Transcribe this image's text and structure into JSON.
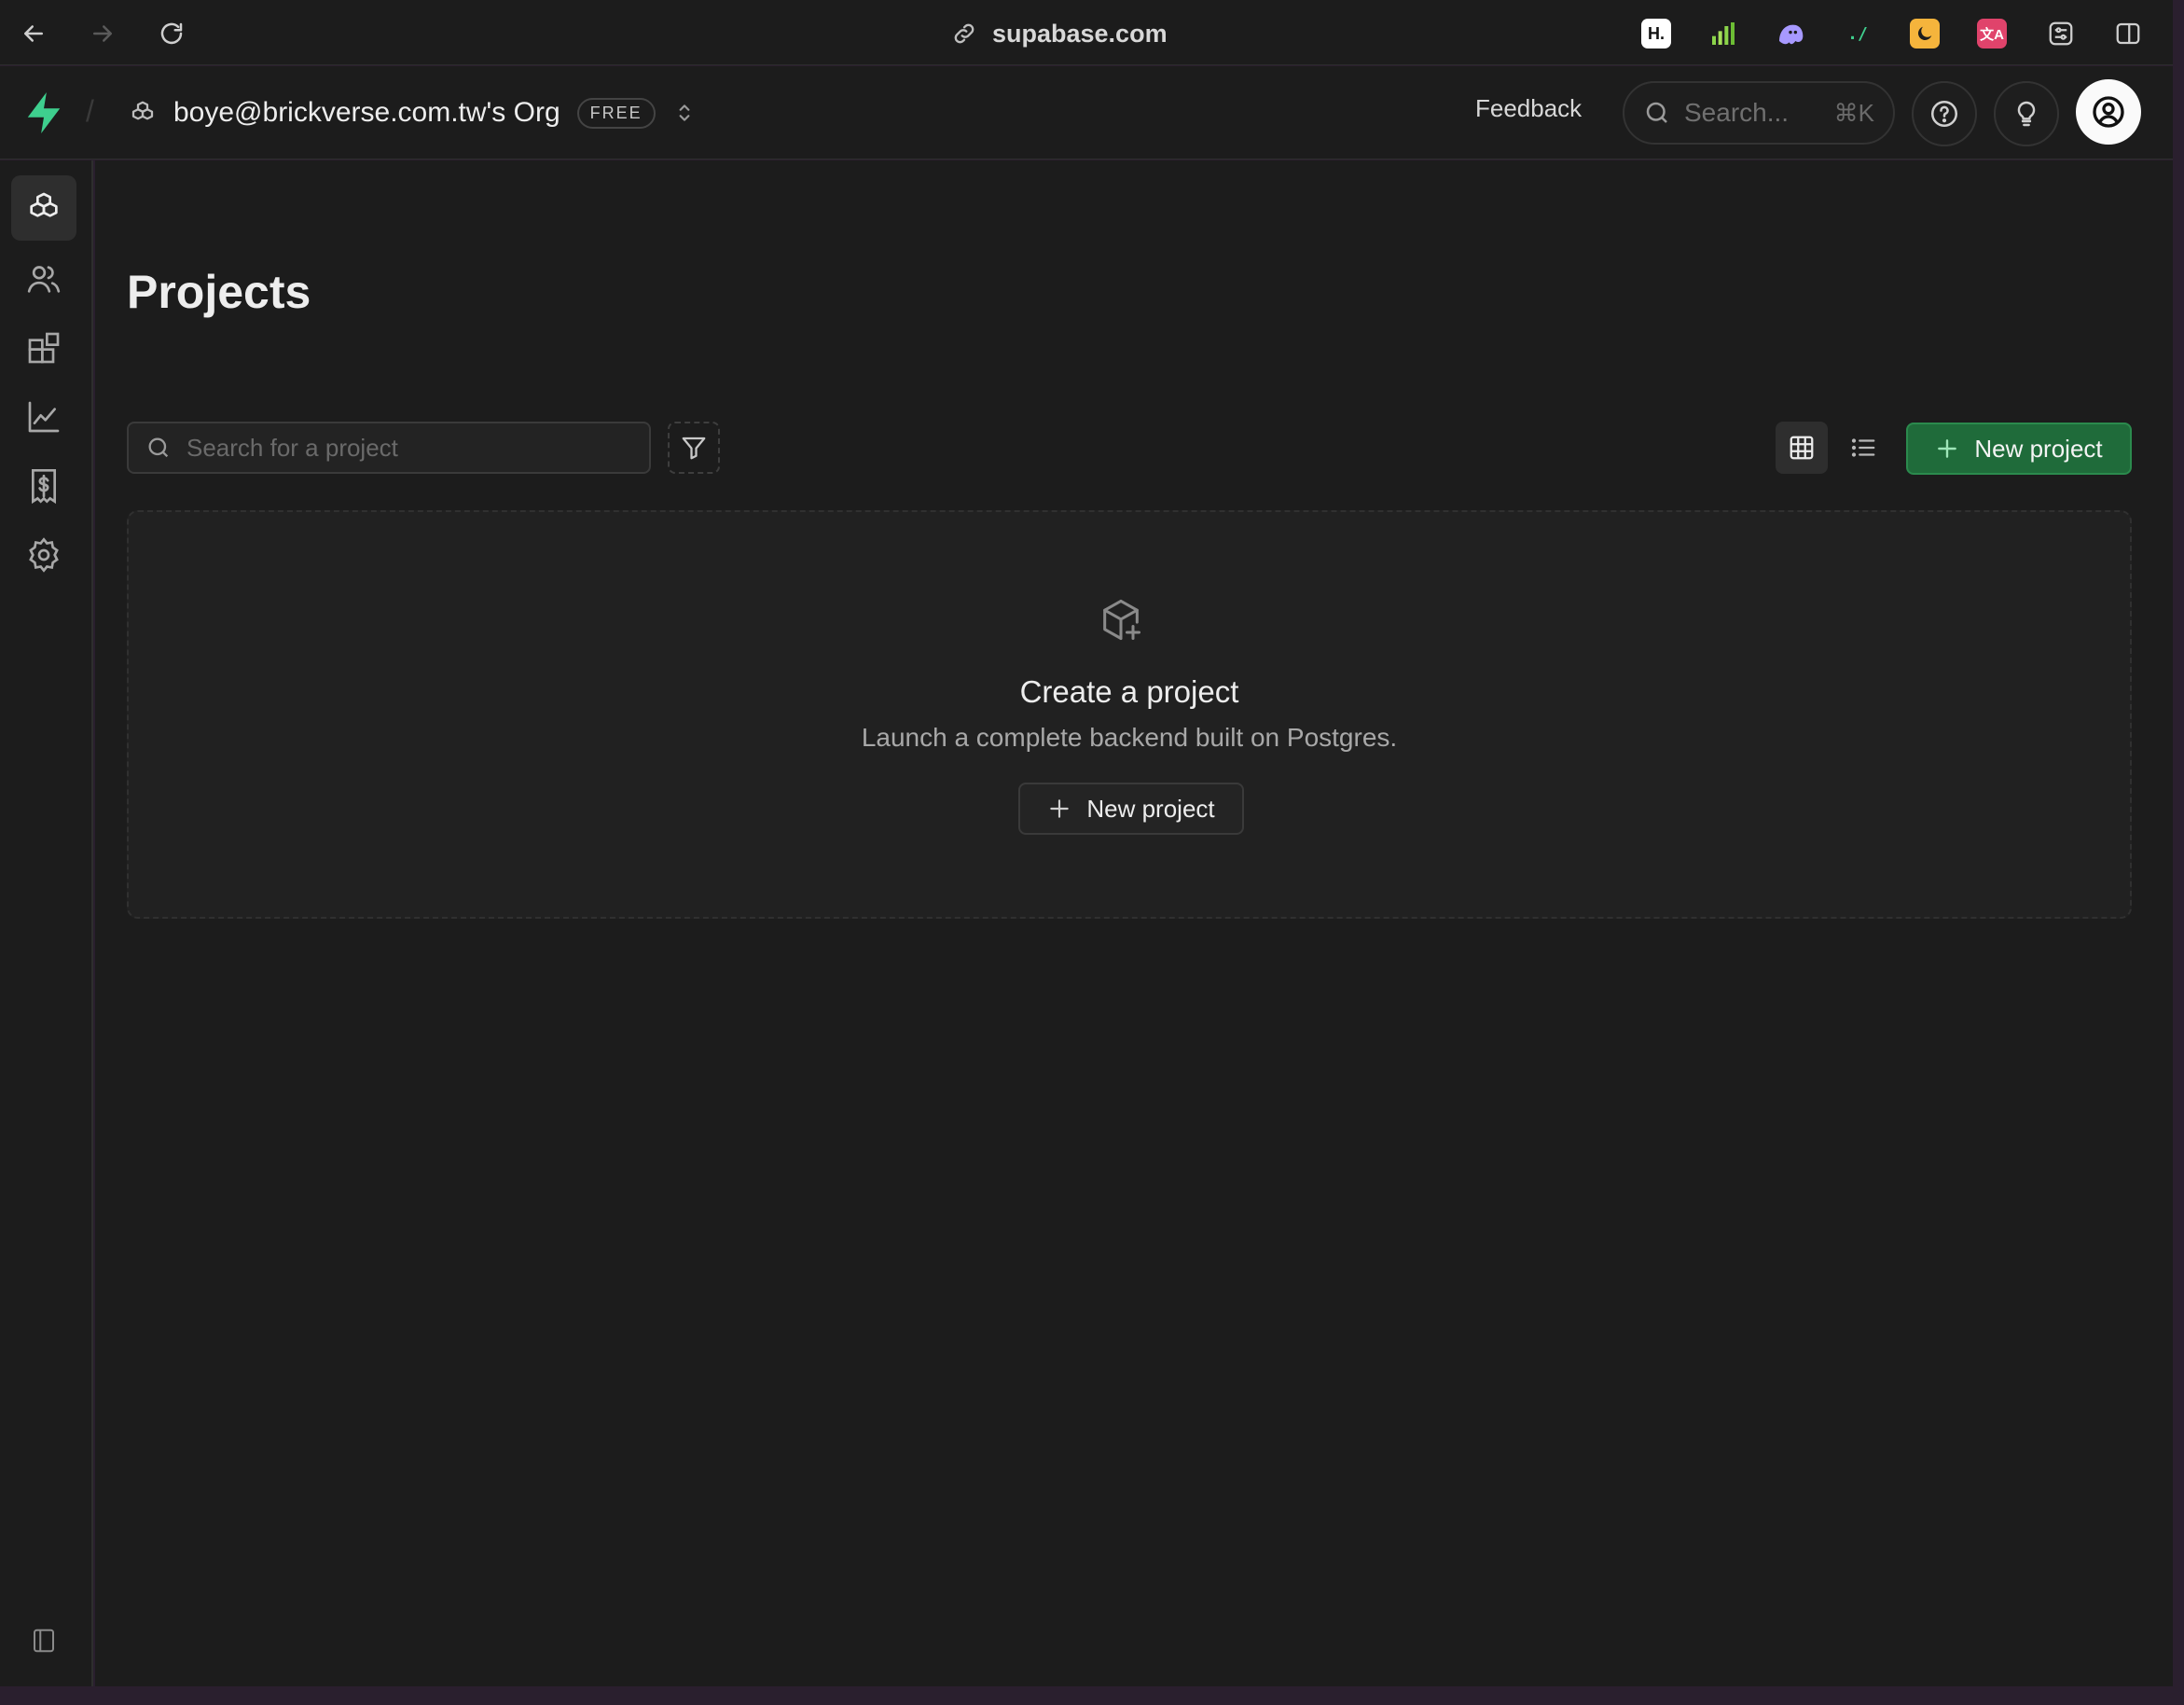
{
  "browser": {
    "url": "supabase.com",
    "extensions": [
      {
        "name": "h-icon",
        "glyph": "H.",
        "bg": "#ffffff",
        "fg": "#111111"
      },
      {
        "name": "stats-icon",
        "glyph": "",
        "bg": "transparent",
        "fg": "#8bd44a"
      },
      {
        "name": "ghost-icon",
        "glyph": "",
        "bg": "transparent",
        "fg": "#9b8cff"
      },
      {
        "name": "terminal-icon",
        "glyph": "./",
        "bg": "transparent",
        "fg": "#3fcf8e"
      },
      {
        "name": "moon-icon",
        "glyph": "",
        "bg": "#f5b43c",
        "fg": "#1c1c1c"
      },
      {
        "name": "translate-icon",
        "glyph": "文A",
        "bg": "#e0436b",
        "fg": "#ffffff"
      }
    ]
  },
  "header": {
    "org_name": "boye@brickverse.com.tw's Org",
    "plan_badge": "FREE",
    "feedback_label": "Feedback",
    "search_placeholder": "Search...",
    "search_shortcut": "⌘K"
  },
  "page": {
    "title": "Projects",
    "search_placeholder": "Search for a project",
    "new_project_label": "New project"
  },
  "empty_state": {
    "title": "Create a project",
    "subtitle": "Launch a complete backend built on Postgres.",
    "button_label": "New project"
  },
  "colors": {
    "brand_green": "#3ecf8e",
    "button_green": "#1f6b3a",
    "background": "#1c1c1c"
  }
}
